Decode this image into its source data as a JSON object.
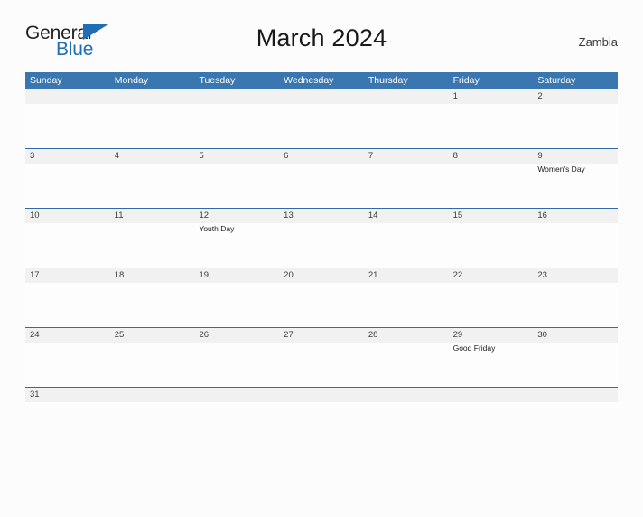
{
  "brand": {
    "name_part1": "General",
    "name_part2": "Blue",
    "triangle_icon": "triangle-icon",
    "accent_color": "#1f6eb5"
  },
  "header": {
    "title": "March 2024",
    "country": "Zambia"
  },
  "theme": {
    "header_bar_color": "#3a77b0",
    "row_divider_color": "#2f6ba5",
    "date_band_color": "#f1f1f1",
    "page_background": "#fcfcfd"
  },
  "calendar": {
    "month": "March",
    "year": "2024",
    "weekday_headers": [
      "Sunday",
      "Monday",
      "Tuesday",
      "Wednesday",
      "Thursday",
      "Friday",
      "Saturday"
    ],
    "weeks": [
      [
        {
          "day": "",
          "event": ""
        },
        {
          "day": "",
          "event": ""
        },
        {
          "day": "",
          "event": ""
        },
        {
          "day": "",
          "event": ""
        },
        {
          "day": "",
          "event": ""
        },
        {
          "day": "1",
          "event": ""
        },
        {
          "day": "2",
          "event": ""
        }
      ],
      [
        {
          "day": "3",
          "event": ""
        },
        {
          "day": "4",
          "event": ""
        },
        {
          "day": "5",
          "event": ""
        },
        {
          "day": "6",
          "event": ""
        },
        {
          "day": "7",
          "event": ""
        },
        {
          "day": "8",
          "event": ""
        },
        {
          "day": "9",
          "event": "Women's Day"
        }
      ],
      [
        {
          "day": "10",
          "event": ""
        },
        {
          "day": "11",
          "event": ""
        },
        {
          "day": "12",
          "event": "Youth Day"
        },
        {
          "day": "13",
          "event": ""
        },
        {
          "day": "14",
          "event": ""
        },
        {
          "day": "15",
          "event": ""
        },
        {
          "day": "16",
          "event": ""
        }
      ],
      [
        {
          "day": "17",
          "event": ""
        },
        {
          "day": "18",
          "event": ""
        },
        {
          "day": "19",
          "event": ""
        },
        {
          "day": "20",
          "event": ""
        },
        {
          "day": "21",
          "event": ""
        },
        {
          "day": "22",
          "event": ""
        },
        {
          "day": "23",
          "event": ""
        }
      ],
      [
        {
          "day": "24",
          "event": ""
        },
        {
          "day": "25",
          "event": ""
        },
        {
          "day": "26",
          "event": ""
        },
        {
          "day": "27",
          "event": ""
        },
        {
          "day": "28",
          "event": ""
        },
        {
          "day": "29",
          "event": "Good Friday"
        },
        {
          "day": "30",
          "event": ""
        }
      ],
      [
        {
          "day": "31",
          "event": ""
        },
        {
          "day": "",
          "event": ""
        },
        {
          "day": "",
          "event": ""
        },
        {
          "day": "",
          "event": ""
        },
        {
          "day": "",
          "event": ""
        },
        {
          "day": "",
          "event": ""
        },
        {
          "day": "",
          "event": ""
        }
      ]
    ]
  }
}
